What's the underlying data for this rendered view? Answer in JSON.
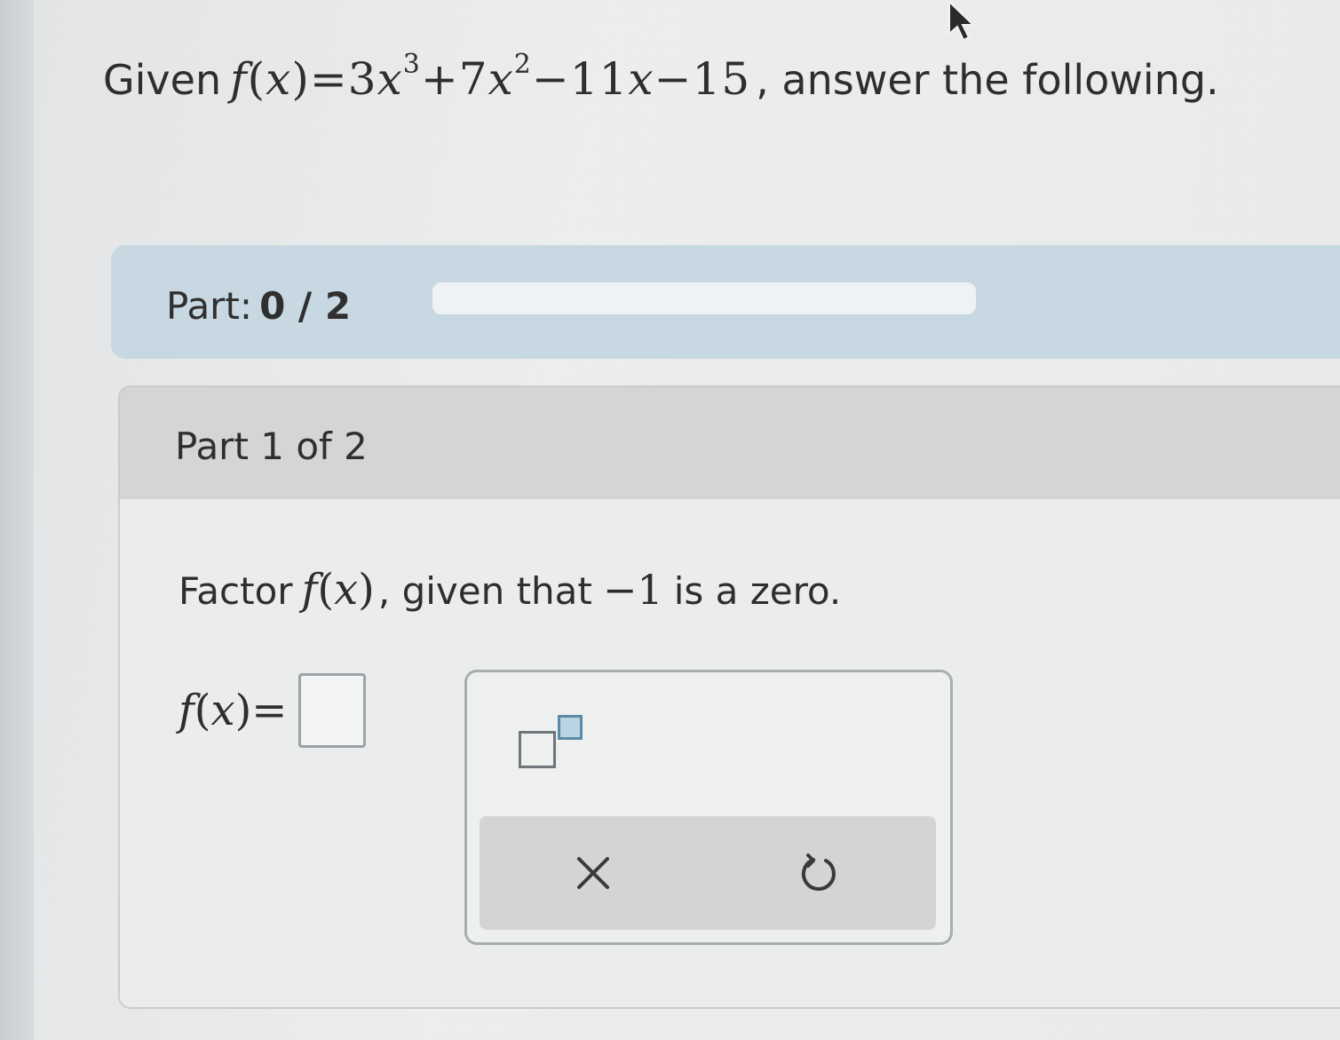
{
  "question": {
    "lead": "Given",
    "function_name": "f",
    "variable": "x",
    "coef3": "3",
    "exp3": "3",
    "coef2": "7",
    "exp2": "2",
    "coef1": "11",
    "constant": "15",
    "tail": ", answer the following."
  },
  "progress": {
    "label": "Part:",
    "value_text": "0 / 2",
    "completed": 0,
    "total": 2
  },
  "part": {
    "header": "Part 1 of 2",
    "prompt_lead": "Factor",
    "prompt_mid": ", given that",
    "zero_value": "−1",
    "prompt_tail": "is a zero."
  },
  "answer": {
    "lhs_function": "f",
    "lhs_variable": "x",
    "value": ""
  },
  "palette": {
    "exponent_button_icon": "superscript-template-icon",
    "clear_icon": "close-icon",
    "undo_icon": "undo-icon"
  },
  "colors": {
    "progress_bar_bg": "#c8d8e2",
    "accent_blue": "#5a8aa5",
    "card_header_bg": "#d3d5d6"
  }
}
